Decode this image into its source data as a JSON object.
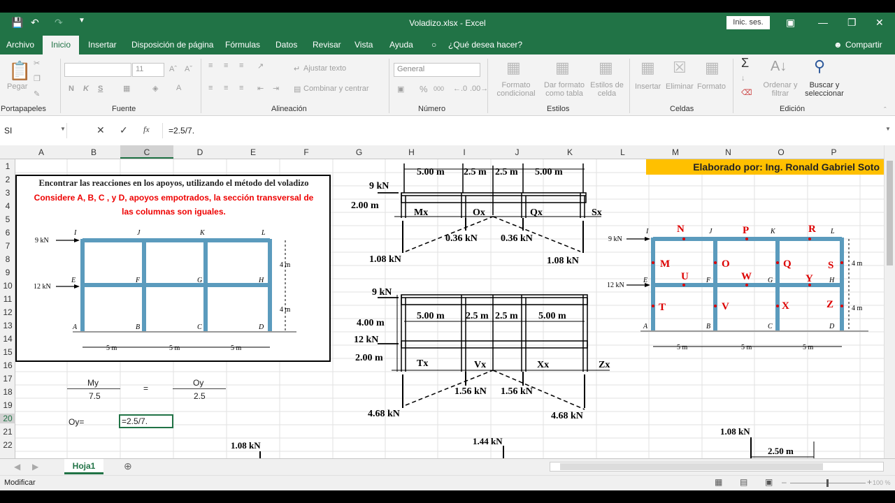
{
  "window": {
    "title": "Voladizo.xlsx  -  Excel",
    "signin": "Inic. ses."
  },
  "menu": {
    "archivo": "Archivo",
    "inicio": "Inicio",
    "insertar": "Insertar",
    "disposicion": "Disposición de página",
    "formulas": "Fórmulas",
    "datos": "Datos",
    "revisar": "Revisar",
    "vista": "Vista",
    "ayuda": "Ayuda",
    "tell": "¿Qué desea hacer?",
    "share": "Compartir"
  },
  "ribbon": {
    "pegar": "Pegar",
    "font_size": "11",
    "bold": "N",
    "italic": "K",
    "underline": "S",
    "ajustar": "Ajustar texto",
    "combinar": "Combinar y centrar",
    "number_format": "General",
    "formato_cond": "Formato\ncondicional",
    "formato_tabla": "Dar formato\ncomo tabla",
    "estilos_celda": "Estilos de\ncelda",
    "insertar": "Insertar",
    "eliminar": "Eliminar",
    "formato": "Formato",
    "ordenar": "Ordenar y\nfiltrar",
    "buscar": "Buscar y\nseleccionar",
    "groups": {
      "portapapeles": "Portapapeles",
      "fuente": "Fuente",
      "alineacion": "Alineación",
      "numero": "Número",
      "estilos": "Estilos",
      "celdas": "Celdas",
      "edicion": "Edición"
    }
  },
  "formula_bar": {
    "name_box": "SI",
    "formula": "=2.5/7."
  },
  "columns": [
    "A",
    "B",
    "C",
    "D",
    "E",
    "F",
    "G",
    "H",
    "I",
    "J",
    "K",
    "L",
    "M",
    "N",
    "O",
    "P"
  ],
  "rows": [
    "1",
    "2",
    "3",
    "4",
    "5",
    "6",
    "7",
    "8",
    "9",
    "10",
    "11",
    "12",
    "13",
    "14",
    "15",
    "16",
    "17",
    "18",
    "19",
    "20",
    "21",
    "22"
  ],
  "sheet": {
    "problem_title": "Encontrar las reacciones en los apoyos, utilizando el método del voladizo",
    "problem_sub1": "Considere A, B, C , y D, apoyos empotrados, la sección transversal de",
    "problem_sub2": "las columnas son iguales.",
    "author": "Elaborado por: Ing. Ronald Gabriel Soto",
    "my": "My",
    "eq": "=",
    "oy": "Oy",
    "v75": "7.5",
    "v25": "2.5",
    "oy_label": "Oy=",
    "edit_cell": "=2.5/7."
  },
  "diagrams": {
    "f9": "9 kN",
    "f12": "12 kN",
    "h4": "4 m",
    "span": "5 m",
    "nodes": {
      "I": "I",
      "J": "J",
      "K": "K",
      "L": "L",
      "E": "E",
      "F": "F",
      "G": "G",
      "H": "H",
      "A": "A",
      "B": "B",
      "C": "C",
      "D": "D"
    },
    "top": {
      "s5a": "5.00 m",
      "s25a": "2.5 m",
      "s25b": "2.5 m",
      "s5b": "5.00 m",
      "h2": "2.00 m",
      "f9": "9 kN",
      "mx": "Mx",
      "ox": "Ox",
      "qx": "Qx",
      "sx": "Sx",
      "r036a": "0.36 kN",
      "r036b": "0.36 kN",
      "r108a": "1.08 kN",
      "r108b": "1.08 kN"
    },
    "mid": {
      "f9": "9 kN",
      "h4": "4.00 m",
      "f12": "12 kN",
      "h2": "2.00 m",
      "s5a": "5.00 m",
      "s25a": "2.5 m",
      "s25b": "2.5 m",
      "s5b": "5.00 m",
      "tx": "Tx",
      "vx": "Vx",
      "xx": "Xx",
      "zx": "Zx",
      "r156a": "1.56 kN",
      "r156b": "1.56 kN",
      "r468a": "4.68 kN",
      "r468b": "4.68 kN"
    },
    "bottom": {
      "r108": "1.08 kN",
      "r144": "1.44 kN",
      "r108c": "1.08 kN",
      "s250": "2.50 m"
    },
    "right_labels": {
      "N": "N",
      "P": "P",
      "R": "R",
      "M": "M",
      "O": "O",
      "Q": "Q",
      "S": "S",
      "U": "U",
      "W": "W",
      "Y": "Y",
      "T": "T",
      "V": "V",
      "X": "X",
      "Z": "Z"
    }
  },
  "tabs": {
    "sheet": "Hoja1"
  },
  "status": {
    "mode": "Modificar",
    "zoom": "100 %"
  }
}
